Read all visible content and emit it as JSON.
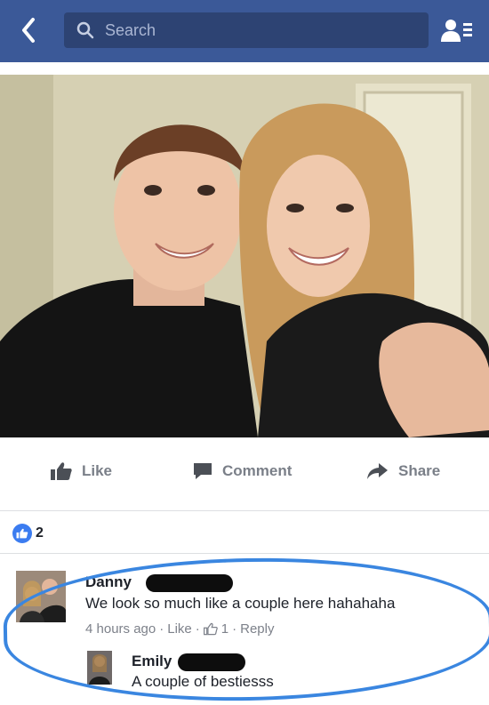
{
  "header": {
    "search_placeholder": "Search",
    "back_icon": "chevron-left-icon",
    "friend_requests_icon": "friend-requests-icon",
    "brand_color": "#3b5998"
  },
  "post": {
    "photo_alt": "selfie photo",
    "actions": {
      "like": "Like",
      "comment": "Comment",
      "share": "Share"
    },
    "reaction_count": "2"
  },
  "comments": [
    {
      "author": "Danny",
      "text": "We look so much like a couple here hahahaha",
      "time": "4 hours ago",
      "like_label": "Like",
      "like_count": "1",
      "reply_label": "Reply"
    },
    {
      "author": "Emily",
      "text": "A couple of bestiesss"
    }
  ],
  "highlight_color": "#3a86e0"
}
